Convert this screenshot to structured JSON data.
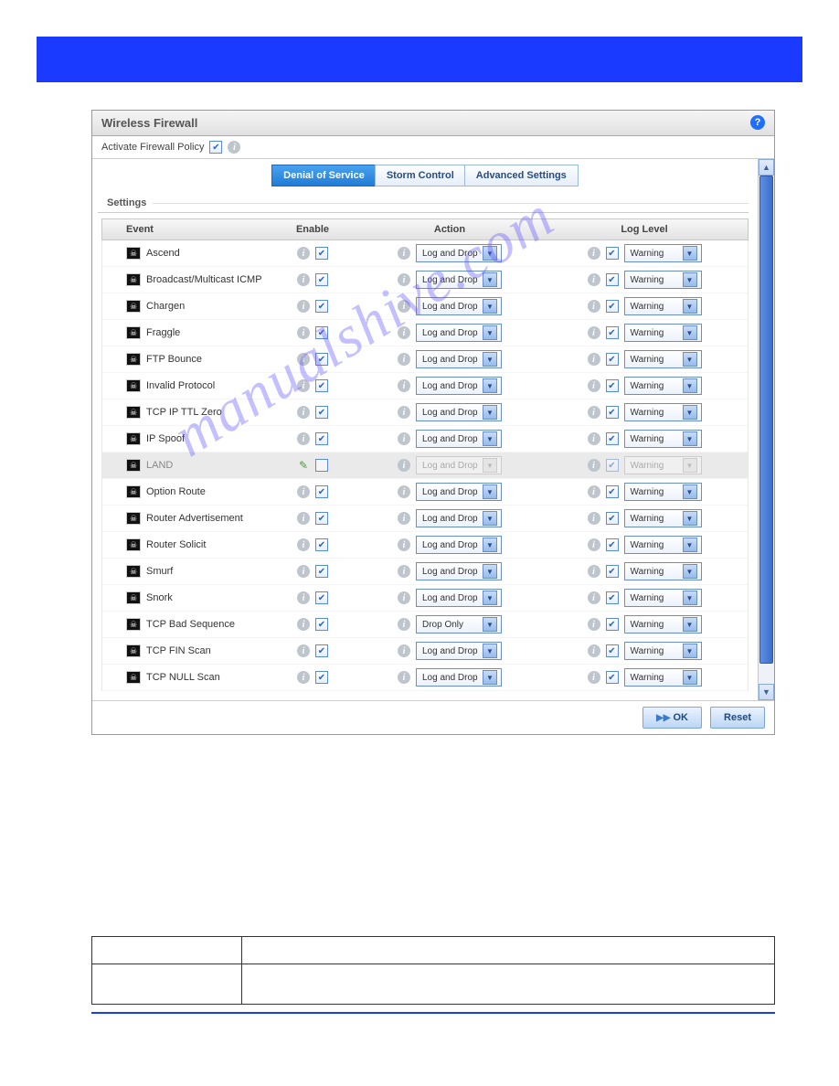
{
  "panel": {
    "title": "Wireless Firewall",
    "policy_label": "Activate Firewall Policy"
  },
  "tabs": [
    {
      "label": "Denial of Service",
      "active": true
    },
    {
      "label": "Storm Control",
      "active": false
    },
    {
      "label": "Advanced Settings",
      "active": false
    }
  ],
  "settings_label": "Settings",
  "columns": {
    "event": "Event",
    "enable": "Enable",
    "action": "Action",
    "log": "Log Level"
  },
  "rows": [
    {
      "event": "Ascend",
      "enable": true,
      "action": "Log and Drop",
      "log": "Warning",
      "log_chk": true,
      "selected": false
    },
    {
      "event": "Broadcast/Multicast ICMP",
      "enable": true,
      "action": "Log and Drop",
      "log": "Warning",
      "log_chk": true,
      "selected": false
    },
    {
      "event": "Chargen",
      "enable": true,
      "action": "Log and Drop",
      "log": "Warning",
      "log_chk": true,
      "selected": false
    },
    {
      "event": "Fraggle",
      "enable": true,
      "action": "Log and Drop",
      "log": "Warning",
      "log_chk": true,
      "selected": false
    },
    {
      "event": "FTP Bounce",
      "enable": true,
      "action": "Log and Drop",
      "log": "Warning",
      "log_chk": true,
      "selected": false
    },
    {
      "event": "Invalid Protocol",
      "enable": true,
      "action": "Log and Drop",
      "log": "Warning",
      "log_chk": true,
      "selected": false
    },
    {
      "event": "TCP IP TTL Zero",
      "enable": true,
      "action": "Log and Drop",
      "log": "Warning",
      "log_chk": true,
      "selected": false
    },
    {
      "event": "IP Spoof",
      "enable": true,
      "action": "Log and Drop",
      "log": "Warning",
      "log_chk": true,
      "selected": false
    },
    {
      "event": "LAND",
      "enable": false,
      "action": "Log and Drop",
      "log": "Warning",
      "log_chk": true,
      "selected": true
    },
    {
      "event": "Option Route",
      "enable": true,
      "action": "Log and Drop",
      "log": "Warning",
      "log_chk": true,
      "selected": false
    },
    {
      "event": "Router Advertisement",
      "enable": true,
      "action": "Log and Drop",
      "log": "Warning",
      "log_chk": true,
      "selected": false
    },
    {
      "event": "Router Solicit",
      "enable": true,
      "action": "Log and Drop",
      "log": "Warning",
      "log_chk": true,
      "selected": false
    },
    {
      "event": "Smurf",
      "enable": true,
      "action": "Log and Drop",
      "log": "Warning",
      "log_chk": true,
      "selected": false
    },
    {
      "event": "Snork",
      "enable": true,
      "action": "Log and Drop",
      "log": "Warning",
      "log_chk": true,
      "selected": false
    },
    {
      "event": "TCP Bad Sequence",
      "enable": true,
      "action": "Drop Only",
      "log": "Warning",
      "log_chk": true,
      "selected": false
    },
    {
      "event": "TCP FIN Scan",
      "enable": true,
      "action": "Log and Drop",
      "log": "Warning",
      "log_chk": true,
      "selected": false
    },
    {
      "event": "TCP NULL Scan",
      "enable": true,
      "action": "Log and Drop",
      "log": "Warning",
      "log_chk": true,
      "selected": false
    }
  ],
  "buttons": {
    "ok": "OK",
    "reset": "Reset"
  },
  "watermark": "manualshive.com"
}
